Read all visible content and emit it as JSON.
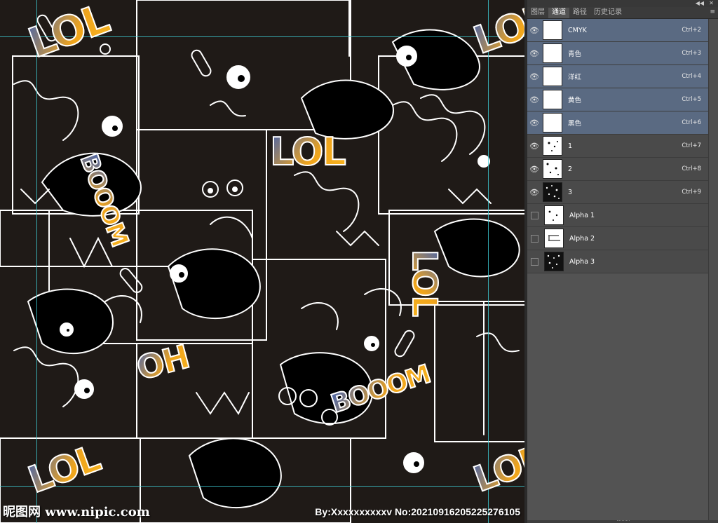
{
  "canvas": {
    "bg_color": "#1f1a17",
    "line_color": "#ffffff",
    "words": [
      {
        "text": "LOL",
        "size": 58,
        "rot": -20
      },
      {
        "text": "LOL",
        "size": 54,
        "rot": 0
      },
      {
        "text": "BOOOM",
        "size": 34,
        "rot": 70
      },
      {
        "text": "LOL",
        "size": 48,
        "rot": 90
      },
      {
        "text": "OH",
        "size": 46,
        "rot": -15
      },
      {
        "text": "BOOOM",
        "size": 36,
        "rot": -18
      },
      {
        "text": "LOL",
        "size": 54,
        "rot": -20
      },
      {
        "text": "LOL",
        "size": 52,
        "rot": -20
      },
      {
        "text": "LOL",
        "size": 50,
        "rot": -20
      }
    ],
    "watermark_left": "昵图网 www.nipic.com",
    "watermark_right": "By:Xxxxxxxxxxv No:20210916205225276105"
  },
  "panel": {
    "tabs": [
      {
        "label": "图层",
        "active": false
      },
      {
        "label": "通道",
        "active": true
      },
      {
        "label": "路径",
        "active": false
      },
      {
        "label": "历史记录",
        "active": false
      }
    ],
    "menu_icon": "≡",
    "collapse_icon": "◀◀",
    "close_icon": "✕",
    "channels": [
      {
        "name": "CMYK",
        "shortcut": "Ctrl+2",
        "visible": true,
        "selected": true,
        "thumb": "white"
      },
      {
        "name": "青色",
        "shortcut": "Ctrl+3",
        "visible": true,
        "selected": true,
        "thumb": "white"
      },
      {
        "name": "洋红",
        "shortcut": "Ctrl+4",
        "visible": true,
        "selected": true,
        "thumb": "white"
      },
      {
        "name": "黄色",
        "shortcut": "Ctrl+5",
        "visible": true,
        "selected": true,
        "thumb": "white"
      },
      {
        "name": "黑色",
        "shortcut": "Ctrl+6",
        "visible": true,
        "selected": true,
        "thumb": "white"
      },
      {
        "name": "1",
        "shortcut": "Ctrl+7",
        "visible": true,
        "selected": false,
        "thumb": "speckle"
      },
      {
        "name": "2",
        "shortcut": "Ctrl+8",
        "visible": true,
        "selected": false,
        "thumb": "speckle"
      },
      {
        "name": "3",
        "shortcut": "Ctrl+9",
        "visible": true,
        "selected": false,
        "thumb": "dark"
      },
      {
        "name": "Alpha 1",
        "shortcut": "",
        "visible": false,
        "selected": false,
        "thumb": "speckle"
      },
      {
        "name": "Alpha 2",
        "shortcut": "",
        "visible": false,
        "selected": false,
        "thumb": "line"
      },
      {
        "name": "Alpha 3",
        "shortcut": "",
        "visible": false,
        "selected": false,
        "thumb": "dark"
      }
    ]
  }
}
